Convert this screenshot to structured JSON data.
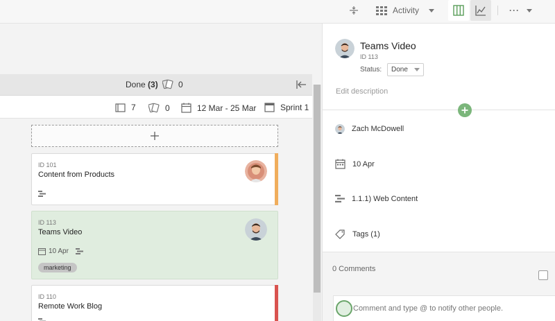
{
  "toolbar": {
    "activity_label": "Activity",
    "more_label": "···"
  },
  "column": {
    "title": "Done",
    "count": "(3)",
    "effort": "0",
    "stats": {
      "cards": "7",
      "effort": "0",
      "date_range": "12 Mar - 25 Mar",
      "sprint": "Sprint 1"
    }
  },
  "cards": [
    {
      "id": "ID 101",
      "title": "Content from Products",
      "bar_color": "#f0ad5c"
    },
    {
      "id": "ID 113",
      "title": "Teams Video",
      "date": "10 Apr",
      "tag": "marketing"
    },
    {
      "id": "ID 110",
      "title": "Remote Work Blog",
      "bar_color": "#d9534f"
    }
  ],
  "panel": {
    "title": "Teams Video",
    "id": "ID 113",
    "status_label": "Status:",
    "status_value": "Done",
    "description_placeholder": "Edit description",
    "assignee": "Zach McDowell",
    "due_date": "10 Apr",
    "epic": "1.1.1) Web Content",
    "tags": "Tags (1)",
    "comments_title": "0 Comments",
    "comment_placeholder": "Comment and type @ to notify other people."
  },
  "colors": {
    "accent_green": "#7bb67b",
    "selected_card": "#e0eddf"
  }
}
